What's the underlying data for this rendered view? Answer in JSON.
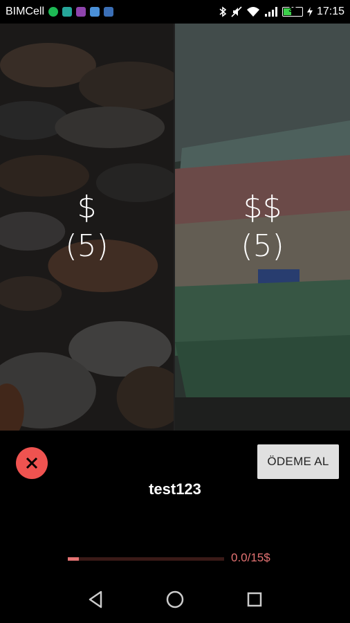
{
  "status_bar": {
    "carrier": "BIMCell",
    "battery": "38",
    "time": "17:15",
    "icons": [
      "spotify-icon",
      "image-icon",
      "app-icon",
      "chat-icon",
      "mail-icon",
      "bluetooth-icon",
      "mute-icon",
      "wifi-icon",
      "signal-icon",
      "battery-icon",
      "charging-icon"
    ]
  },
  "tiers": [
    {
      "symbol": "$",
      "count": "(5)",
      "image": "coins"
    },
    {
      "symbol": "$$",
      "count": "(5)",
      "image": "banknotes"
    }
  ],
  "panel": {
    "pay_button": "ÖDEME AL",
    "username": "test123",
    "progress_text": "0.0/15$",
    "progress_fraction": 0.07
  },
  "colors": {
    "accent": "#ef5350",
    "progress": "#e57373"
  },
  "nav": [
    "back-icon",
    "home-icon",
    "recents-icon"
  ]
}
